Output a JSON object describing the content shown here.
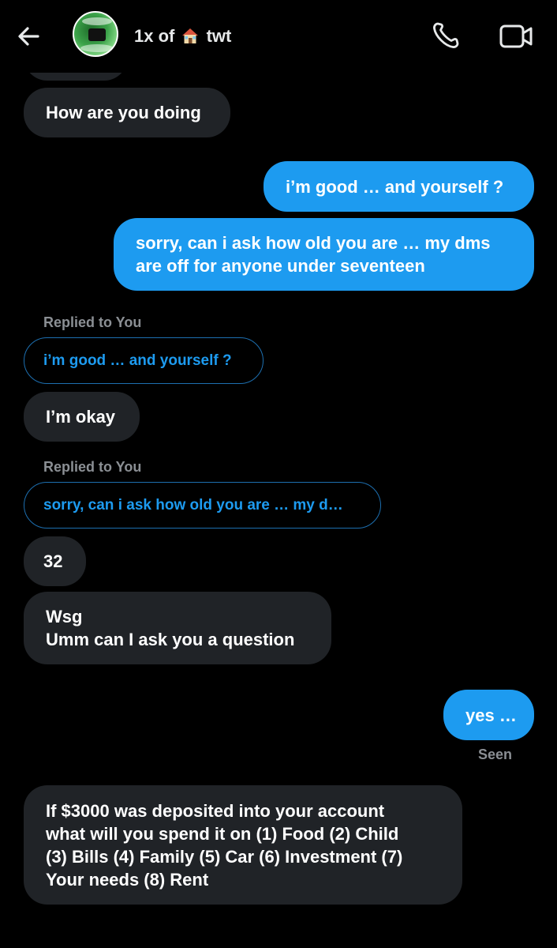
{
  "header": {
    "chat_name_prefix": "1x of",
    "chat_name_suffix": "twt",
    "chat_name_emoji_icon": "house-emoji-icon",
    "icons": [
      "back-arrow-icon",
      "phone-icon",
      "video-camera-icon"
    ]
  },
  "messages": [
    {
      "side": "in",
      "text": "How are you doing"
    },
    {
      "side": "out",
      "text": "i’m good … and yourself ?"
    },
    {
      "side": "out",
      "lines": [
        "sorry, can i ask how old you are … my dms",
        "are off for anyone under seventeen"
      ]
    },
    {
      "side": "in",
      "reply_label": "Replied to You",
      "quoted": "i’m good … and yourself ?",
      "text": "I’m okay"
    },
    {
      "side": "in",
      "reply_label": "Replied to You",
      "quoted": "sorry, can i ask how old you are … my d…",
      "text": "32"
    },
    {
      "side": "in",
      "lines": [
        "Wsg",
        "Umm can I ask you a question"
      ]
    },
    {
      "side": "out",
      "text": "yes …",
      "status": "Seen"
    },
    {
      "side": "in",
      "lines": [
        "If $3000 was deposited into your account",
        "what will you spend it on (1) Food (2) Child",
        "(3) Bills (4) Family (5) Car (6) Investment (7)",
        "Your needs (8) Rent"
      ]
    }
  ],
  "colors": {
    "background": "#000000",
    "incoming_bubble": "#202327",
    "outgoing_bubble": "#1d9bf0",
    "quoted_text": "#1d9bf0",
    "meta_text": "#8b8f94"
  }
}
